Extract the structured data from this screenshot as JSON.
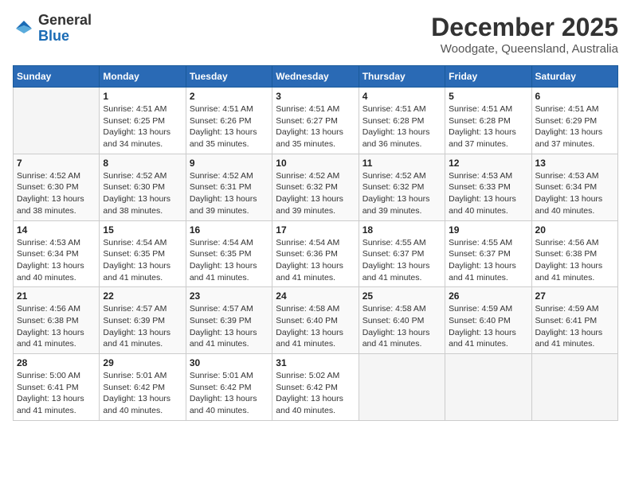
{
  "header": {
    "logo": {
      "general": "General",
      "blue": "Blue"
    },
    "title": "December 2025",
    "location": "Woodgate, Queensland, Australia"
  },
  "weekdays": [
    "Sunday",
    "Monday",
    "Tuesday",
    "Wednesday",
    "Thursday",
    "Friday",
    "Saturday"
  ],
  "weeks": [
    [
      {
        "day": "",
        "info": ""
      },
      {
        "day": "1",
        "info": "Sunrise: 4:51 AM\nSunset: 6:25 PM\nDaylight: 13 hours\nand 34 minutes."
      },
      {
        "day": "2",
        "info": "Sunrise: 4:51 AM\nSunset: 6:26 PM\nDaylight: 13 hours\nand 35 minutes."
      },
      {
        "day": "3",
        "info": "Sunrise: 4:51 AM\nSunset: 6:27 PM\nDaylight: 13 hours\nand 35 minutes."
      },
      {
        "day": "4",
        "info": "Sunrise: 4:51 AM\nSunset: 6:28 PM\nDaylight: 13 hours\nand 36 minutes."
      },
      {
        "day": "5",
        "info": "Sunrise: 4:51 AM\nSunset: 6:28 PM\nDaylight: 13 hours\nand 37 minutes."
      },
      {
        "day": "6",
        "info": "Sunrise: 4:51 AM\nSunset: 6:29 PM\nDaylight: 13 hours\nand 37 minutes."
      }
    ],
    [
      {
        "day": "7",
        "info": "Sunrise: 4:52 AM\nSunset: 6:30 PM\nDaylight: 13 hours\nand 38 minutes."
      },
      {
        "day": "8",
        "info": "Sunrise: 4:52 AM\nSunset: 6:30 PM\nDaylight: 13 hours\nand 38 minutes."
      },
      {
        "day": "9",
        "info": "Sunrise: 4:52 AM\nSunset: 6:31 PM\nDaylight: 13 hours\nand 39 minutes."
      },
      {
        "day": "10",
        "info": "Sunrise: 4:52 AM\nSunset: 6:32 PM\nDaylight: 13 hours\nand 39 minutes."
      },
      {
        "day": "11",
        "info": "Sunrise: 4:52 AM\nSunset: 6:32 PM\nDaylight: 13 hours\nand 39 minutes."
      },
      {
        "day": "12",
        "info": "Sunrise: 4:53 AM\nSunset: 6:33 PM\nDaylight: 13 hours\nand 40 minutes."
      },
      {
        "day": "13",
        "info": "Sunrise: 4:53 AM\nSunset: 6:34 PM\nDaylight: 13 hours\nand 40 minutes."
      }
    ],
    [
      {
        "day": "14",
        "info": "Sunrise: 4:53 AM\nSunset: 6:34 PM\nDaylight: 13 hours\nand 40 minutes."
      },
      {
        "day": "15",
        "info": "Sunrise: 4:54 AM\nSunset: 6:35 PM\nDaylight: 13 hours\nand 41 minutes."
      },
      {
        "day": "16",
        "info": "Sunrise: 4:54 AM\nSunset: 6:35 PM\nDaylight: 13 hours\nand 41 minutes."
      },
      {
        "day": "17",
        "info": "Sunrise: 4:54 AM\nSunset: 6:36 PM\nDaylight: 13 hours\nand 41 minutes."
      },
      {
        "day": "18",
        "info": "Sunrise: 4:55 AM\nSunset: 6:37 PM\nDaylight: 13 hours\nand 41 minutes."
      },
      {
        "day": "19",
        "info": "Sunrise: 4:55 AM\nSunset: 6:37 PM\nDaylight: 13 hours\nand 41 minutes."
      },
      {
        "day": "20",
        "info": "Sunrise: 4:56 AM\nSunset: 6:38 PM\nDaylight: 13 hours\nand 41 minutes."
      }
    ],
    [
      {
        "day": "21",
        "info": "Sunrise: 4:56 AM\nSunset: 6:38 PM\nDaylight: 13 hours\nand 41 minutes."
      },
      {
        "day": "22",
        "info": "Sunrise: 4:57 AM\nSunset: 6:39 PM\nDaylight: 13 hours\nand 41 minutes."
      },
      {
        "day": "23",
        "info": "Sunrise: 4:57 AM\nSunset: 6:39 PM\nDaylight: 13 hours\nand 41 minutes."
      },
      {
        "day": "24",
        "info": "Sunrise: 4:58 AM\nSunset: 6:40 PM\nDaylight: 13 hours\nand 41 minutes."
      },
      {
        "day": "25",
        "info": "Sunrise: 4:58 AM\nSunset: 6:40 PM\nDaylight: 13 hours\nand 41 minutes."
      },
      {
        "day": "26",
        "info": "Sunrise: 4:59 AM\nSunset: 6:40 PM\nDaylight: 13 hours\nand 41 minutes."
      },
      {
        "day": "27",
        "info": "Sunrise: 4:59 AM\nSunset: 6:41 PM\nDaylight: 13 hours\nand 41 minutes."
      }
    ],
    [
      {
        "day": "28",
        "info": "Sunrise: 5:00 AM\nSunset: 6:41 PM\nDaylight: 13 hours\nand 41 minutes."
      },
      {
        "day": "29",
        "info": "Sunrise: 5:01 AM\nSunset: 6:42 PM\nDaylight: 13 hours\nand 40 minutes."
      },
      {
        "day": "30",
        "info": "Sunrise: 5:01 AM\nSunset: 6:42 PM\nDaylight: 13 hours\nand 40 minutes."
      },
      {
        "day": "31",
        "info": "Sunrise: 5:02 AM\nSunset: 6:42 PM\nDaylight: 13 hours\nand 40 minutes."
      },
      {
        "day": "",
        "info": ""
      },
      {
        "day": "",
        "info": ""
      },
      {
        "day": "",
        "info": ""
      }
    ]
  ]
}
